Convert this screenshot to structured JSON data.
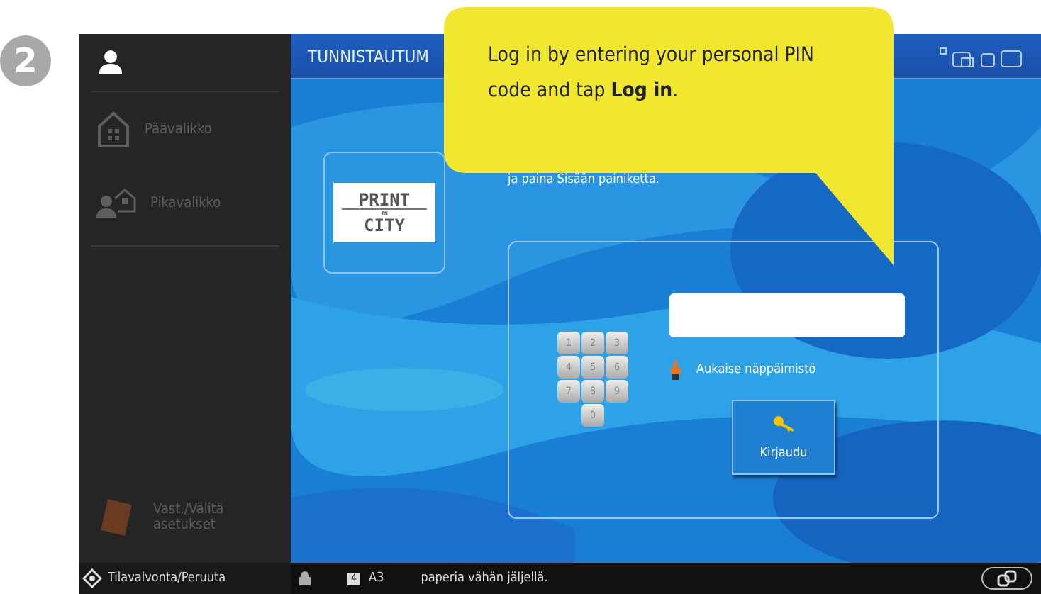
{
  "step": "2",
  "sidebar": {
    "items": [
      {
        "kind": "home",
        "label": "Päävalikko",
        "disabled": true
      },
      {
        "kind": "quick",
        "label": "Pikavalikko",
        "disabled": true
      }
    ],
    "bottom_item": {
      "label": "Vast./Välitä\nasetukset",
      "disabled": true
    }
  },
  "header": {
    "title": "TUNNISTAUTUM"
  },
  "logo": {
    "top": "PRINT",
    "middle": "IN",
    "bottom": "CITY"
  },
  "instruction": "ja paina Sisään painiketta.",
  "login": {
    "keypad": [
      "1",
      "2",
      "3",
      "4",
      "5",
      "6",
      "7",
      "8",
      "9",
      "0"
    ],
    "keyboard_hint": "Aukaise näppäimistö",
    "login_button": "Kirjaudu"
  },
  "status_bar": {
    "left": "Tilavalvonta/Peruuta",
    "paper_tray": "4",
    "paper_size": "A3",
    "message": "paperia vähän jäljellä."
  },
  "callout": "Log in by entering your personal PIN code and tap **Log in**."
}
